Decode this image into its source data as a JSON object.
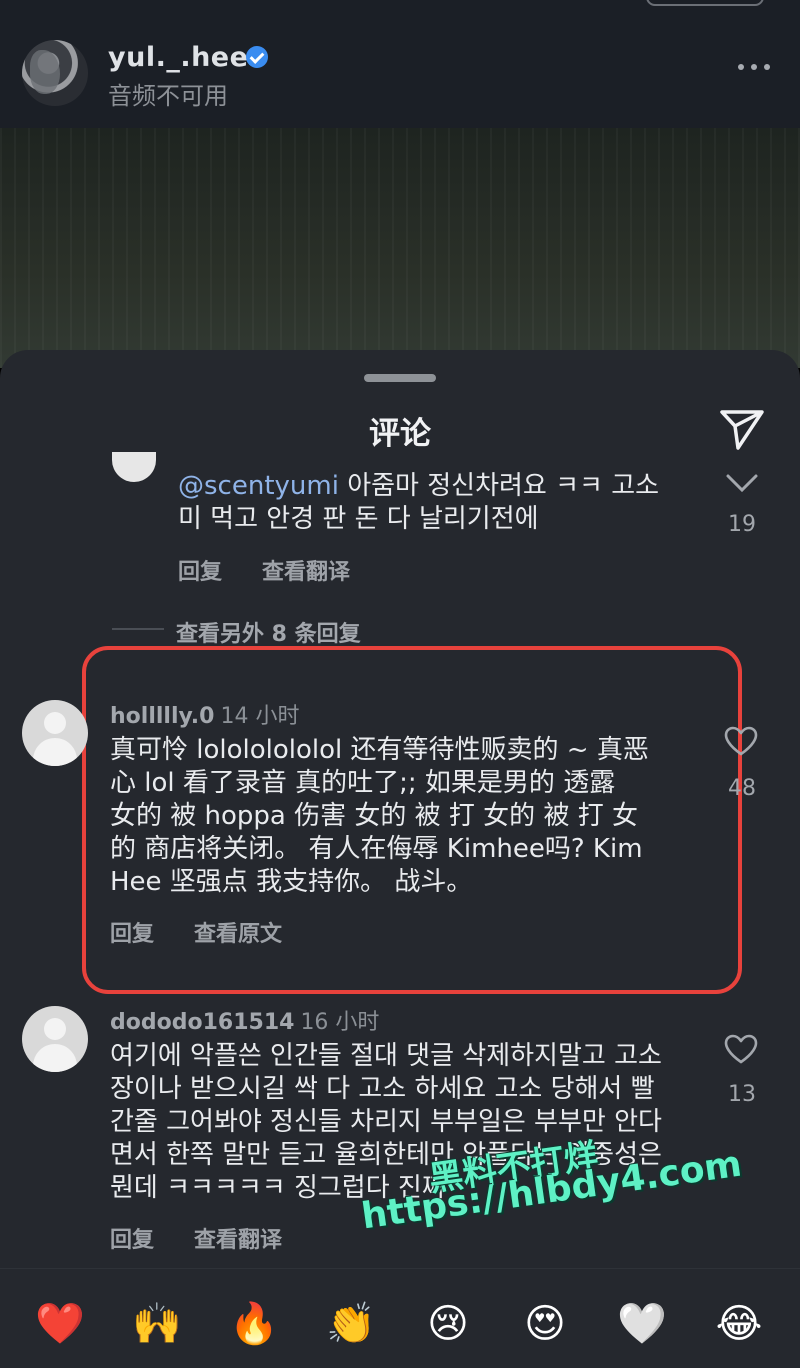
{
  "header": {
    "username": "yul._.hee",
    "audio_status": "音频不可用"
  },
  "sheet": {
    "title": "评论"
  },
  "comments": [
    {
      "text_mention": "@scentyumi",
      "text_line1": " 아줌마 정신차려요 ㅋㅋ 고소",
      "text_line2": "미 먹고 안경 판 돈 다 날리기전에",
      "reply": "回复",
      "translate": "查看翻译",
      "likes": "19"
    },
    {
      "username": "hollllly.0",
      "time": "14 小时",
      "lines": [
        "真可怜 lolololololol 还有等待性贩卖的 ~ 真恶",
        "心 lol 看了录音 真的吐了;; 如果是男的 透露",
        "女的 被 hoppa 伤害 女的 被 打 女的 被 打 女",
        "的 商店将关闭。 有人在侮辱 Kimhee吗? Kim",
        "Hee 坚强点 我支持你。 战斗。"
      ],
      "reply": "回复",
      "translate": "查看原文",
      "likes": "48"
    },
    {
      "username": "dododo161514",
      "time": "16 小时",
      "lines": [
        "여기에 악플쓴 인간들 절대 댓글 삭제하지말고 고소",
        "장이나 받으시길 싹 다 고소 하세요 고소 당해서 빨",
        "간줄 그어봐야 정신들 차리지 부부일은 부부만 안다",
        "면서 한쪽 말만 듣고 율희한테만 악플다는 이중성은",
        "뭔데 ㅋㅋㅋㅋㅋ 징그럽다 진짜"
      ],
      "reply": "回复",
      "translate": "查看翻译",
      "likes": "13"
    }
  ],
  "view_more_replies": "查看另外 8 条回复",
  "emoji_bar": [
    "❤️",
    "🙌",
    "🔥",
    "👏",
    "😢",
    "😍",
    "🤍",
    "😂"
  ],
  "watermark": {
    "line1": "黑料不打烊",
    "line2": "https://hlbdy4.com"
  },
  "colors": {
    "highlight": "#e8423c",
    "sheet_bg": "#25282e",
    "watermark": "#5ef1c5"
  }
}
